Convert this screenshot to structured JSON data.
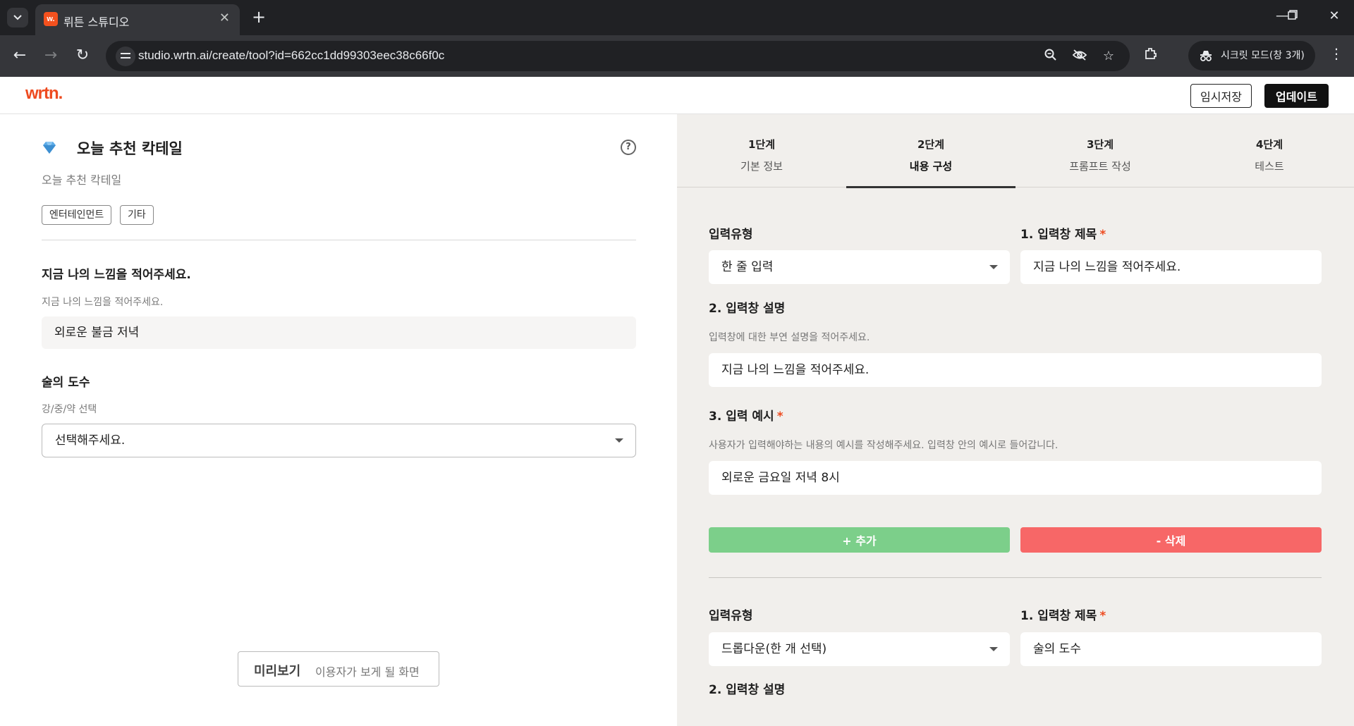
{
  "browser": {
    "tab_title": "뤼튼 스튜디오",
    "tab_favicon_text": "w.",
    "url": "studio.wrtn.ai/create/tool?id=662cc1dd99303eec38c66f0c",
    "incognito_label": "시크릿 모드(창 3개)"
  },
  "header": {
    "logo": "wrtn.",
    "save_label": "임시저장",
    "update_label": "업데이트"
  },
  "left": {
    "tool_title": "오늘 추천 칵테일",
    "tool_desc": "오늘 추천 칵테일",
    "tags": [
      "엔터테인먼트",
      "기타"
    ],
    "field1": {
      "label": "지금 나의 느낌을 적어주세요.",
      "sub": "지금 나의 느낌을 적어주세요.",
      "value": "외로운 불금 저녁"
    },
    "field2": {
      "label": "술의 도수",
      "sub": "강/중/약 선택",
      "value": "선택해주세요."
    },
    "preview": {
      "main": "미리보기",
      "sub": "이용자가 보게 될 화면"
    }
  },
  "steps": [
    {
      "num": "1단계",
      "name": "기본 정보"
    },
    {
      "num": "2단계",
      "name": "내용 구성"
    },
    {
      "num": "3단계",
      "name": "프롬프트 작성"
    },
    {
      "num": "4단계",
      "name": "테스트"
    }
  ],
  "block1": {
    "type_label": "입력유형",
    "type_value": "한 줄 입력",
    "title_label": "1. 입력창 제목",
    "title_value": "지금 나의 느낌을 적어주세요.",
    "desc_label": "2. 입력창 설명",
    "desc_sub": "입력창에 대한 부연 설명을 적어주세요.",
    "desc_value": "지금 나의 느낌을 적어주세요.",
    "example_label": "3. 입력 예시",
    "example_sub": "사용자가 입력해야하는 내용의 예시를 작성해주세요. 입력창 안의 예시로 들어갑니다.",
    "example_value": "외로운 금요일 저녁 8시",
    "add_label": "+ 추가",
    "delete_label": "- 삭제"
  },
  "block2": {
    "type_label": "입력유형",
    "type_value": "드롭다운(한 개 선택)",
    "title_label": "1. 입력창 제목",
    "title_value": "술의 도수",
    "desc_label": "2. 입력창 설명"
  },
  "required_mark": "*",
  "colors": {
    "brand": "#ee4b20",
    "add": "#7ccf8a",
    "delete": "#f76767",
    "right_bg": "#f1efec"
  }
}
